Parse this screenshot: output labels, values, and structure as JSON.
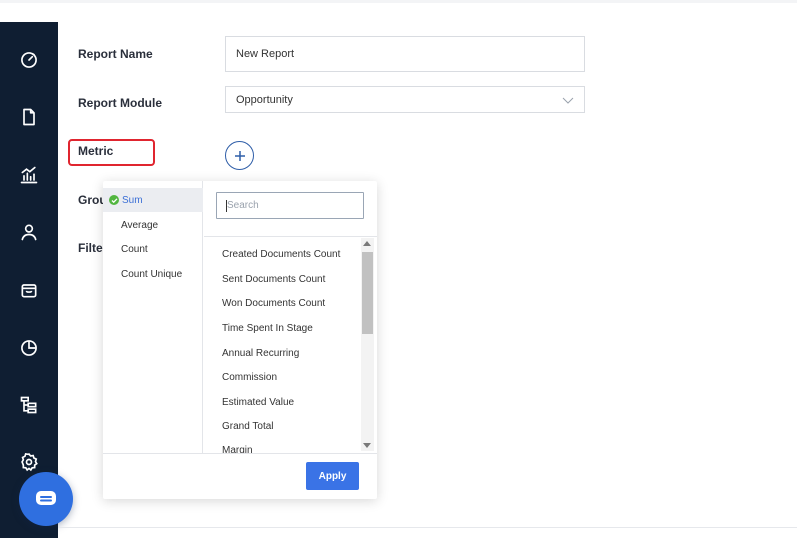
{
  "form": {
    "report_name_label": "Report Name",
    "report_name_value": "New Report",
    "report_module_label": "Report Module",
    "report_module_value": "Opportunity",
    "metric_label": "Metric",
    "group_label_partial": "Grou",
    "filter_label_partial": "Filte"
  },
  "sidebar": {
    "icons": [
      "speedometer-icon",
      "document-icon",
      "bar-chart-icon",
      "user-icon",
      "shopping-bag-icon",
      "pie-chart-icon",
      "hierarchy-icon",
      "gear-icon"
    ],
    "background": "#0f1e32"
  },
  "dropdown": {
    "aggregations": [
      {
        "label": "Sum",
        "selected": true
      },
      {
        "label": "Average",
        "selected": false
      },
      {
        "label": "Count",
        "selected": false
      },
      {
        "label": "Count Unique",
        "selected": false
      }
    ],
    "search_placeholder": "Search",
    "fields": [
      "Created Documents Count",
      "Sent Documents Count",
      "Won Documents Count",
      "Time Spent In Stage",
      "Annual Recurring",
      "Commission",
      "Estimated Value",
      "Grand Total",
      "Margin"
    ],
    "apply_label": "Apply"
  },
  "colors": {
    "accent": "#3a73e6",
    "highlight": "#e0252f",
    "selected_check": "#52b640"
  }
}
